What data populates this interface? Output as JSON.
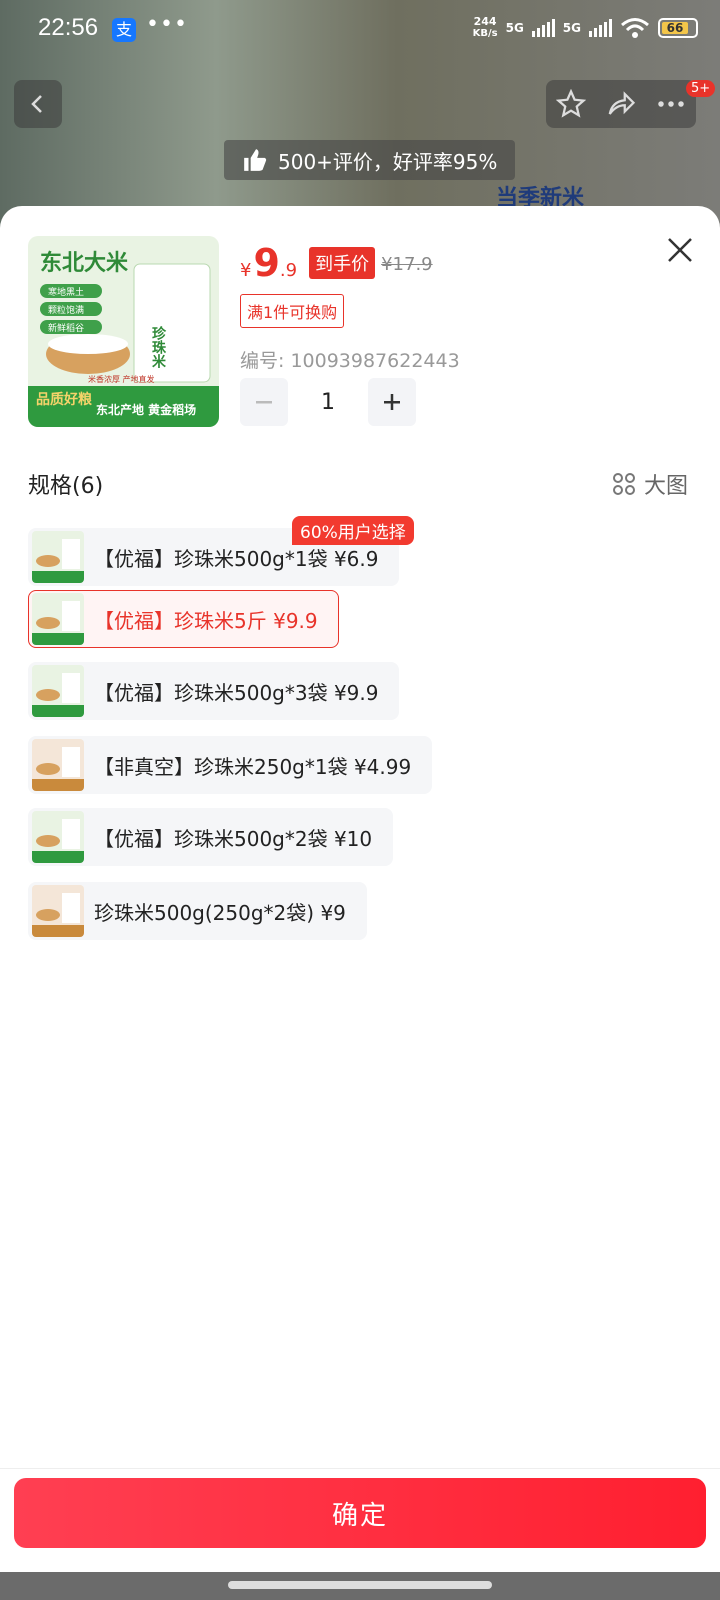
{
  "status_bar": {
    "time": "22:56",
    "alipay_icon": "支",
    "more": "•••",
    "net_speed": "244",
    "net_unit": "KB/s",
    "sim1": "5G",
    "sim2": "5G",
    "battery": "66"
  },
  "header": {
    "badge": "5+",
    "review_summary": "500+评价，好评率95%",
    "promo_text": "当季新米"
  },
  "product": {
    "yen": "¥",
    "price_int": "9",
    "price_dec": ".9",
    "final_tag": "到手价",
    "original_price": "¥17.9",
    "swap_tag": "满1件可换购",
    "sku_code": "编号: 10093987622443",
    "quantity": "1",
    "image_text": {
      "title": "东北大米",
      "badge1": "寒地黑土",
      "badge2": "颗粒饱满",
      "badge3": "新鲜稻谷",
      "bag": "珍珠米",
      "quality": "品质好粮",
      "origin": "东北产地 黄金稻场",
      "small": "米香浓厚 产地直发"
    }
  },
  "specs": {
    "title": "规格(6)",
    "big_view": "大图",
    "hot_badge": "60%用户选择",
    "options": [
      {
        "label": "【优福】珍珠米500g*1袋",
        "price": "¥6.9"
      },
      {
        "label": "【优福】珍珠米5斤",
        "price": "¥9.9"
      },
      {
        "label": "【优福】珍珠米500g*3袋",
        "price": "¥9.9"
      },
      {
        "label": "【非真空】珍珠米250g*1袋",
        "price": "¥4.99"
      },
      {
        "label": "【优福】珍珠米500g*2袋",
        "price": "¥10"
      },
      {
        "label": "珍珠米500g(250g*2袋)",
        "price": "¥9"
      }
    ]
  },
  "footer": {
    "confirm_label": "确定"
  },
  "colors": {
    "accent": "#e8332a",
    "confirm_start": "#ff3f52",
    "confirm_end": "#ff1f30"
  }
}
